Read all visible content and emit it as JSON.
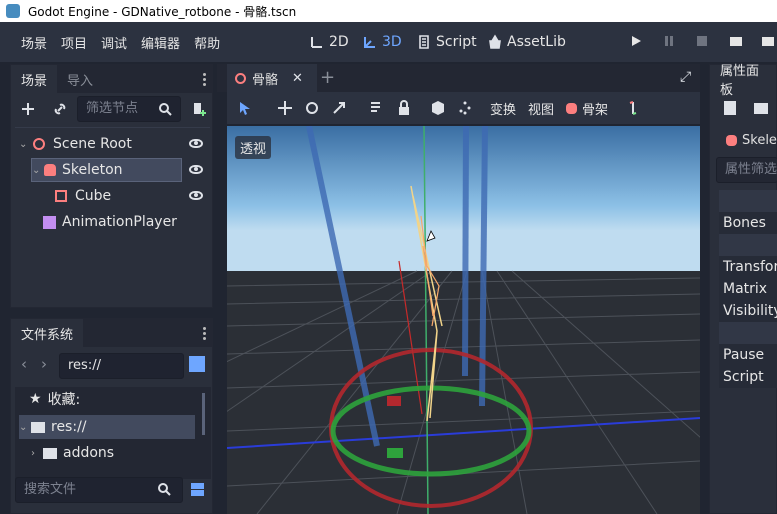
{
  "window": {
    "title": "Godot Engine - GDNative_rotbone - 骨骼.tscn"
  },
  "menu": {
    "items": [
      "场景",
      "项目",
      "调试",
      "编辑器",
      "帮助"
    ]
  },
  "workspaces": {
    "w2d": "2D",
    "w3d": "3D",
    "script": "Script",
    "assetlib": "AssetLib"
  },
  "scene_dock": {
    "tabs": [
      "场景",
      "导入"
    ],
    "filter_placeholder": "筛选节点",
    "nodes": [
      "Scene Root",
      "Skeleton",
      "Cube",
      "AnimationPlayer"
    ]
  },
  "filesystem_dock": {
    "tab": "文件系统",
    "path": "res://",
    "favorites": "收藏:",
    "root": "res://",
    "folder": "addons",
    "search_placeholder": "搜索文件"
  },
  "editor": {
    "scene_tab": "骨骼",
    "toolbar_labels": [
      "变换",
      "视图",
      "骨架"
    ],
    "perspective_label": "透视"
  },
  "inspector": {
    "tab": "属性面板",
    "object": "Skelet",
    "filter_placeholder": "属性筛选",
    "rows": [
      "Bones",
      "Transfor",
      "Matrix",
      "Visibility",
      "Pause",
      "Script"
    ]
  },
  "colors": {
    "accent": "#6ea6ff",
    "panel": "#2a2f3b",
    "background": "#202531"
  }
}
